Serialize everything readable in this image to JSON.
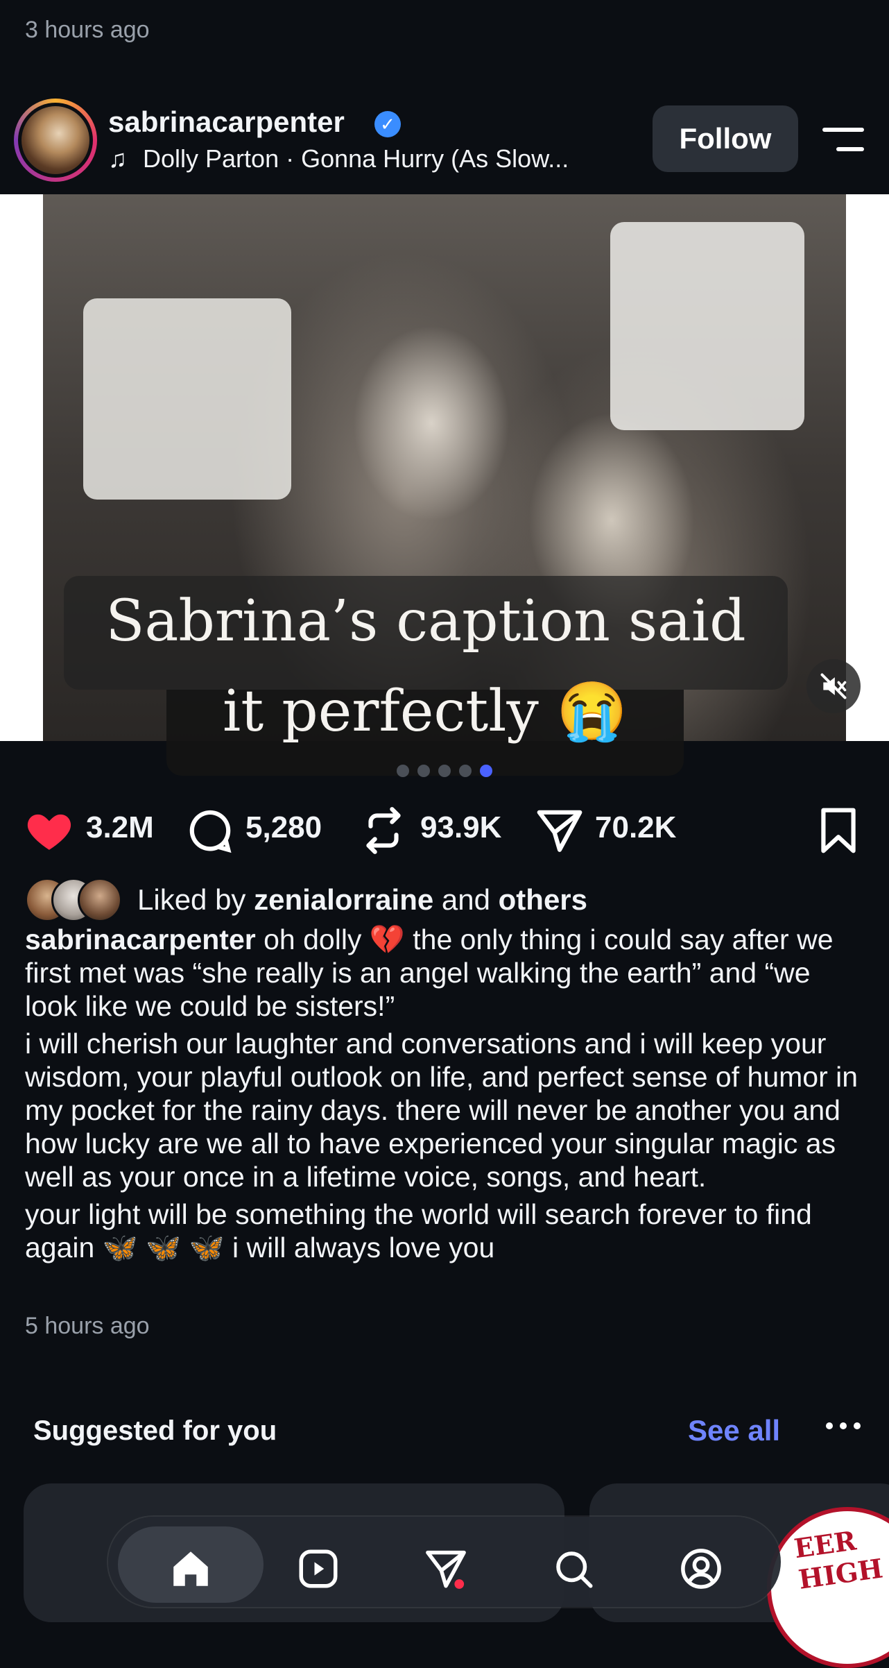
{
  "previous_post": {
    "time": "3 hours ago"
  },
  "post": {
    "username": "sabrinacarpenter",
    "verified_icon": "verified-badge-icon",
    "music": "Dolly Parton · Gonna Hurry (As Slow...",
    "follow_label": "Follow",
    "media_overlay": {
      "line1": "Sabrina’s caption said",
      "line2": "it perfectly 😭"
    },
    "carousel": {
      "total": 5,
      "active_index": 4
    },
    "actions": {
      "likes": "3.2M",
      "comments": "5,280",
      "reposts": "93.9K",
      "shares": "70.2K"
    },
    "liked_by": {
      "prefix": "Liked by ",
      "name": "zenialorraine",
      "middle": " and ",
      "others": "others"
    },
    "caption": {
      "author": "sabrinacarpenter",
      "p1": " oh dolly 💔 the only thing i could say after we first met was “she really is an angel walking the earth” and “we look like we could be sisters!”",
      "p2": "i will cherish our laughter and conversations and i will keep your wisdom, your playful outlook on life, and perfect sense of humor in my pocket for the rainy days. there will never be another you and how lucky are we all to have experienced your singular magic as well as your once in a lifetime voice, songs, and heart.",
      "p3": "your light will be something the world will search forever to find again 🦋 🦋 🦋 i will always love you"
    },
    "time": "5 hours ago"
  },
  "suggested": {
    "title": "Suggested for you",
    "see_all": "See all",
    "card_text": "EER HIGH"
  },
  "colors": {
    "background": "#0b0e13",
    "accent": "#6f84ff",
    "like": "#ff2d4b",
    "verified": "#3a8dff"
  },
  "nav": [
    "home-icon",
    "reels-icon",
    "direct-message-icon",
    "search-icon",
    "profile-icon"
  ]
}
